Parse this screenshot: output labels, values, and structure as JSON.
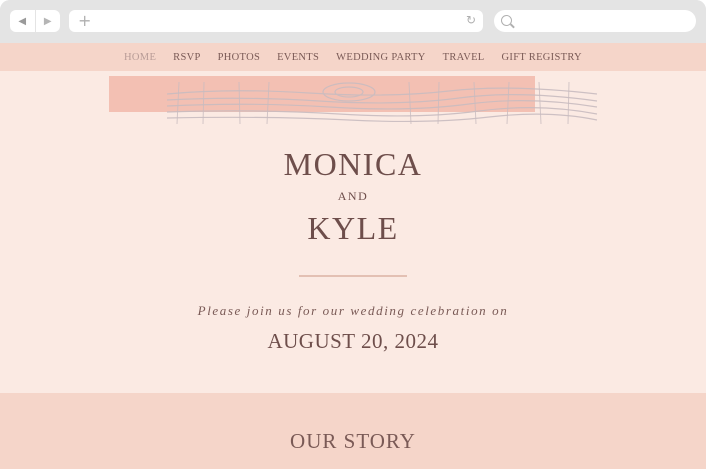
{
  "browser": {
    "back_icon": "◀",
    "forward_icon": "▶",
    "new_tab_icon": "+",
    "reload_icon": "↻",
    "url_value": "",
    "search_value": ""
  },
  "nav": {
    "items": [
      {
        "label": "HOME",
        "active": true
      },
      {
        "label": "RSVP"
      },
      {
        "label": "PHOTOS"
      },
      {
        "label": "EVENTS"
      },
      {
        "label": "WEDDING PARTY"
      },
      {
        "label": "TRAVEL"
      },
      {
        "label": "GIFT REGISTRY"
      }
    ]
  },
  "hero": {
    "name1": "MONICA",
    "and": "AND",
    "name2": "KYLE",
    "invite": "Please join us for our wedding celebration on",
    "date": "AUGUST 20, 2024"
  },
  "story": {
    "title": "OUR STORY"
  },
  "colors": {
    "page_bg": "#fbeae3",
    "band_bg": "#f5d5c9",
    "text": "#6e4e4b",
    "wood_pink": "#f1b9aa",
    "wood_gray": "#c9bcc0"
  }
}
